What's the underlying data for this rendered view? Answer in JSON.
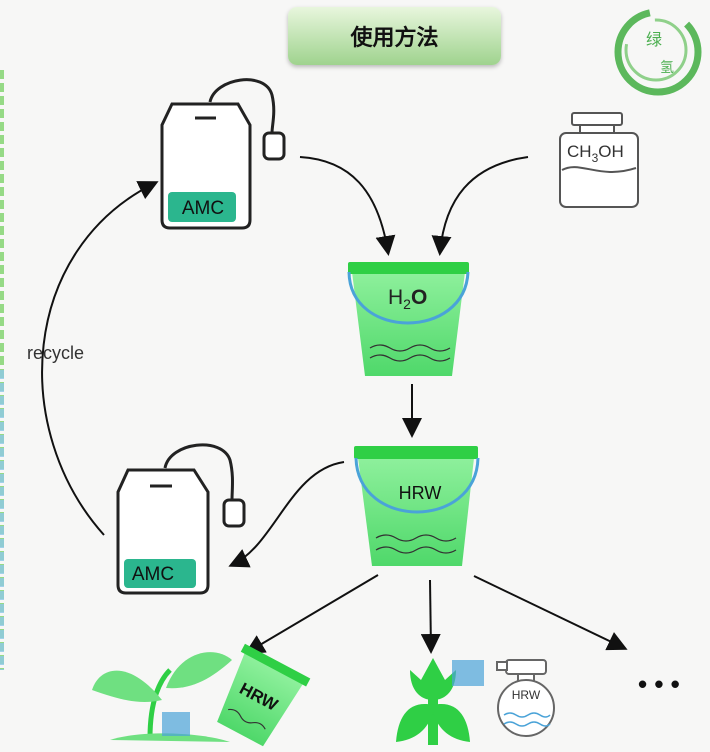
{
  "title": "使用方法",
  "logo": {
    "text": "绿氢",
    "color": "#4caf50"
  },
  "colors": {
    "bucket_green": "#63e27a",
    "bucket_rim": "#2fcf45",
    "bag_fill": "#2bb68e",
    "handle_blue": "#4aa3d8"
  },
  "labels": {
    "amc_top": "AMC",
    "amc_bottom": "AMC",
    "recycle": "recycle",
    "bucket_water": "H",
    "bucket_water_sub": "2",
    "bucket_water_o": "O",
    "bucket_hrw": "HRW",
    "bottle_main": "CH",
    "bottle_sub": "3",
    "bottle_tail": "OH",
    "bottom_cup": "HRW",
    "sprayer": "HRW",
    "ellipsis": "• • •"
  }
}
